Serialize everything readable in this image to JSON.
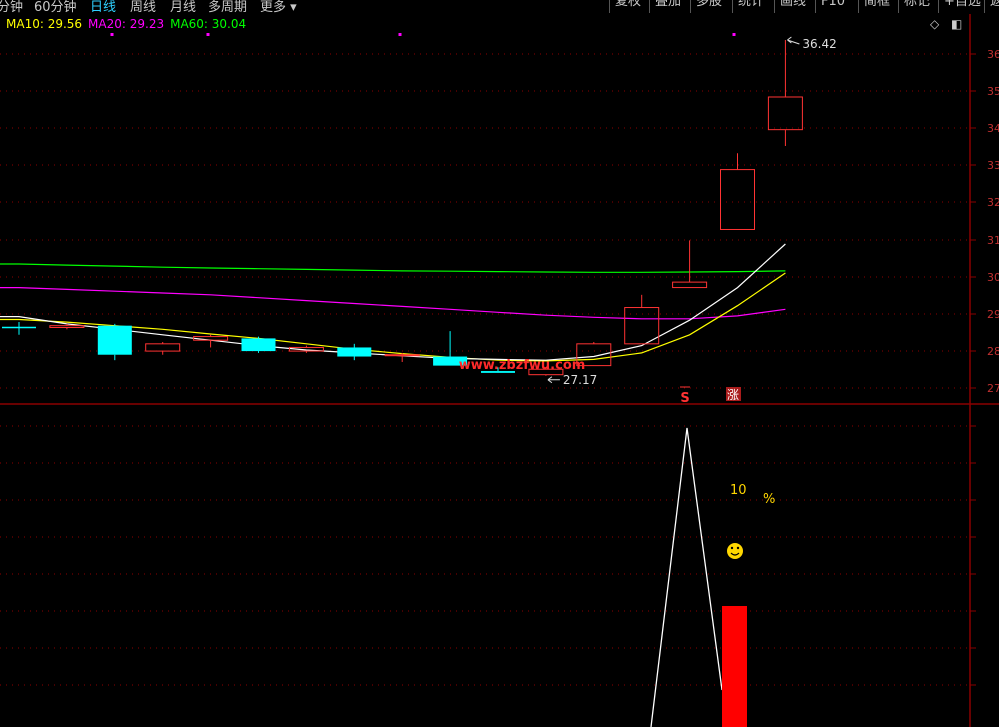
{
  "toolbar": {
    "period_tabs": [
      "分钟",
      "60分钟",
      "日线",
      "周线",
      "月线",
      "多周期",
      "更多 ▾"
    ],
    "active_tab": "日线",
    "right_buttons": [
      "复权",
      "叠加",
      "多股",
      "统计",
      "画线",
      "F10",
      "简框",
      "标记",
      "+自选",
      "返"
    ]
  },
  "ma_legend": [
    {
      "label": "MA10: 29.56",
      "color": "#ffff00"
    },
    {
      "label": "MA20: 29.23",
      "color": "#ff00ff"
    },
    {
      "label": "MA60: 30.04",
      "color": "#00ff00"
    }
  ],
  "watermark": "www.zbzfwu.com",
  "colors": {
    "up": "#ff3333",
    "down": "#00ffff",
    "ma10": "#ffff00",
    "ma20": "#ff00ff",
    "ma60": "#00ff00",
    "white_line": "#ffffff",
    "grid": "#8b0000",
    "volume_bar": "#ff0000"
  },
  "chart_data": {
    "type": "candlestick",
    "candles": [
      {
        "o": 28.5,
        "h": 28.65,
        "l": 28.3,
        "c": 28.5,
        "dir": "flat"
      },
      {
        "o": 28.5,
        "h": 28.6,
        "l": 28.45,
        "c": 28.55,
        "dir": "up"
      },
      {
        "o": 28.55,
        "h": 28.6,
        "l": 27.6,
        "c": 27.75,
        "dir": "down"
      },
      {
        "o": 27.85,
        "h": 28.1,
        "l": 27.75,
        "c": 28.05,
        "dir": "up"
      },
      {
        "o": 28.15,
        "h": 28.3,
        "l": 27.95,
        "c": 28.25,
        "dir": "up"
      },
      {
        "o": 28.2,
        "h": 28.25,
        "l": 27.8,
        "c": 27.85,
        "dir": "down"
      },
      {
        "o": 27.85,
        "h": 28.0,
        "l": 27.8,
        "c": 27.95,
        "dir": "up"
      },
      {
        "o": 27.95,
        "h": 28.05,
        "l": 27.6,
        "c": 27.7,
        "dir": "down"
      },
      {
        "o": 27.75,
        "h": 27.8,
        "l": 27.55,
        "c": 27.75,
        "dir": "up"
      },
      {
        "o": 27.7,
        "h": 28.4,
        "l": 27.45,
        "c": 27.45,
        "dir": "down"
      },
      {
        "o": 27.3,
        "h": 27.4,
        "l": 27.25,
        "c": 27.25,
        "dir": "down"
      },
      {
        "o": 27.2,
        "h": 27.4,
        "l": 27.17,
        "c": 27.35,
        "dir": "up"
      },
      {
        "o": 27.45,
        "h": 28.1,
        "l": 27.45,
        "c": 28.05,
        "dir": "up"
      },
      {
        "o": 28.05,
        "h": 29.4,
        "l": 28.05,
        "c": 29.05,
        "dir": "up"
      },
      {
        "o": 29.6,
        "h": 30.9,
        "l": 29.6,
        "c": 29.75,
        "dir": "up"
      },
      {
        "o": 31.2,
        "h": 33.3,
        "l": 31.2,
        "c": 32.85,
        "dir": "up"
      },
      {
        "o": 33.95,
        "h": 36.42,
        "l": 33.5,
        "c": 34.85,
        "dir": "up"
      }
    ],
    "high_label": "36.42",
    "low_label": "27.17",
    "ma10": [
      28.72,
      28.65,
      28.55,
      28.45,
      28.32,
      28.2,
      28.05,
      27.9,
      27.78,
      27.68,
      27.6,
      27.58,
      27.62,
      27.8,
      28.3,
      29.1,
      30.0
    ],
    "ma20": [
      29.6,
      29.55,
      29.5,
      29.45,
      29.4,
      29.32,
      29.24,
      29.16,
      29.08,
      29.0,
      28.92,
      28.84,
      28.78,
      28.74,
      28.74,
      28.82,
      29.0
    ],
    "ma60": [
      30.25,
      30.22,
      30.19,
      30.16,
      30.14,
      30.12,
      30.1,
      30.08,
      30.06,
      30.05,
      30.04,
      30.03,
      30.02,
      30.02,
      30.03,
      30.04,
      30.06
    ],
    "mid_line": [
      28.8,
      28.6,
      28.45,
      28.3,
      28.15,
      28.0,
      27.88,
      27.8,
      27.72,
      27.65,
      27.62,
      27.6,
      27.7,
      28.0,
      28.7,
      29.6,
      30.8
    ],
    "y_axis_ticks": [
      "36",
      "35",
      "34",
      "33",
      "32",
      "31",
      "30",
      "29",
      "28",
      "27"
    ],
    "indicator": {
      "peak_value": "10",
      "percent_sign": "%",
      "signal_s": "S",
      "signal_zhang": "涨",
      "smiley": "☺"
    }
  }
}
